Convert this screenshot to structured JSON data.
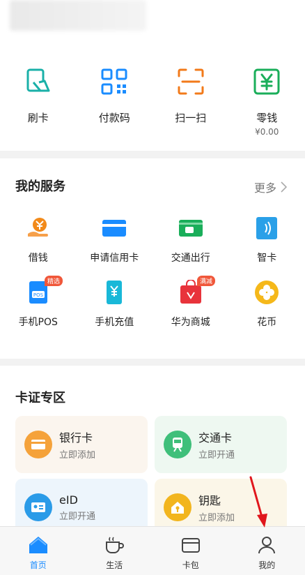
{
  "quick": [
    {
      "label": "刷卡",
      "icon": "card-swipe-icon"
    },
    {
      "label": "付款码",
      "icon": "qr-code-icon"
    },
    {
      "label": "扫一扫",
      "icon": "scan-icon"
    },
    {
      "label": "零钱",
      "icon": "yuan-wallet-icon",
      "sub": "¥0.00"
    }
  ],
  "services": {
    "title": "我的服务",
    "more": "更多",
    "items": [
      {
        "label": "借钱",
        "icon": "loan-icon"
      },
      {
        "label": "申请信用卡",
        "icon": "credit-card-icon"
      },
      {
        "label": "交通出行",
        "icon": "bus-card-icon"
      },
      {
        "label": "智卡",
        "icon": "nfc-card-icon"
      },
      {
        "label": "手机POS",
        "icon": "pos-icon",
        "tag": "精选"
      },
      {
        "label": "手机充值",
        "icon": "phone-recharge-icon"
      },
      {
        "label": "华为商城",
        "icon": "shopping-bag-icon",
        "tag": "满减"
      },
      {
        "label": "花币",
        "icon": "clover-coin-icon"
      }
    ]
  },
  "cards_zone": {
    "title": "卡证专区",
    "cards": [
      {
        "title": "银行卡",
        "sub": "立即添加",
        "icon": "bank-card-icon"
      },
      {
        "title": "交通卡",
        "sub": "立即开通",
        "icon": "train-icon"
      },
      {
        "title": "eID",
        "sub": "立即开通",
        "icon": "id-card-icon"
      },
      {
        "title": "钥匙",
        "sub": "立即添加",
        "icon": "home-key-icon"
      }
    ]
  },
  "tabbar": [
    {
      "label": "首页",
      "icon": "home-icon",
      "active": true
    },
    {
      "label": "生活",
      "icon": "coffee-cup-icon"
    },
    {
      "label": "卡包",
      "icon": "wallet-icon"
    },
    {
      "label": "我的",
      "icon": "person-icon"
    }
  ],
  "colors": {
    "accent": "#1a8cff",
    "teal": "#1ab0a8",
    "orange": "#f27a1a",
    "green": "#1aae5a"
  }
}
